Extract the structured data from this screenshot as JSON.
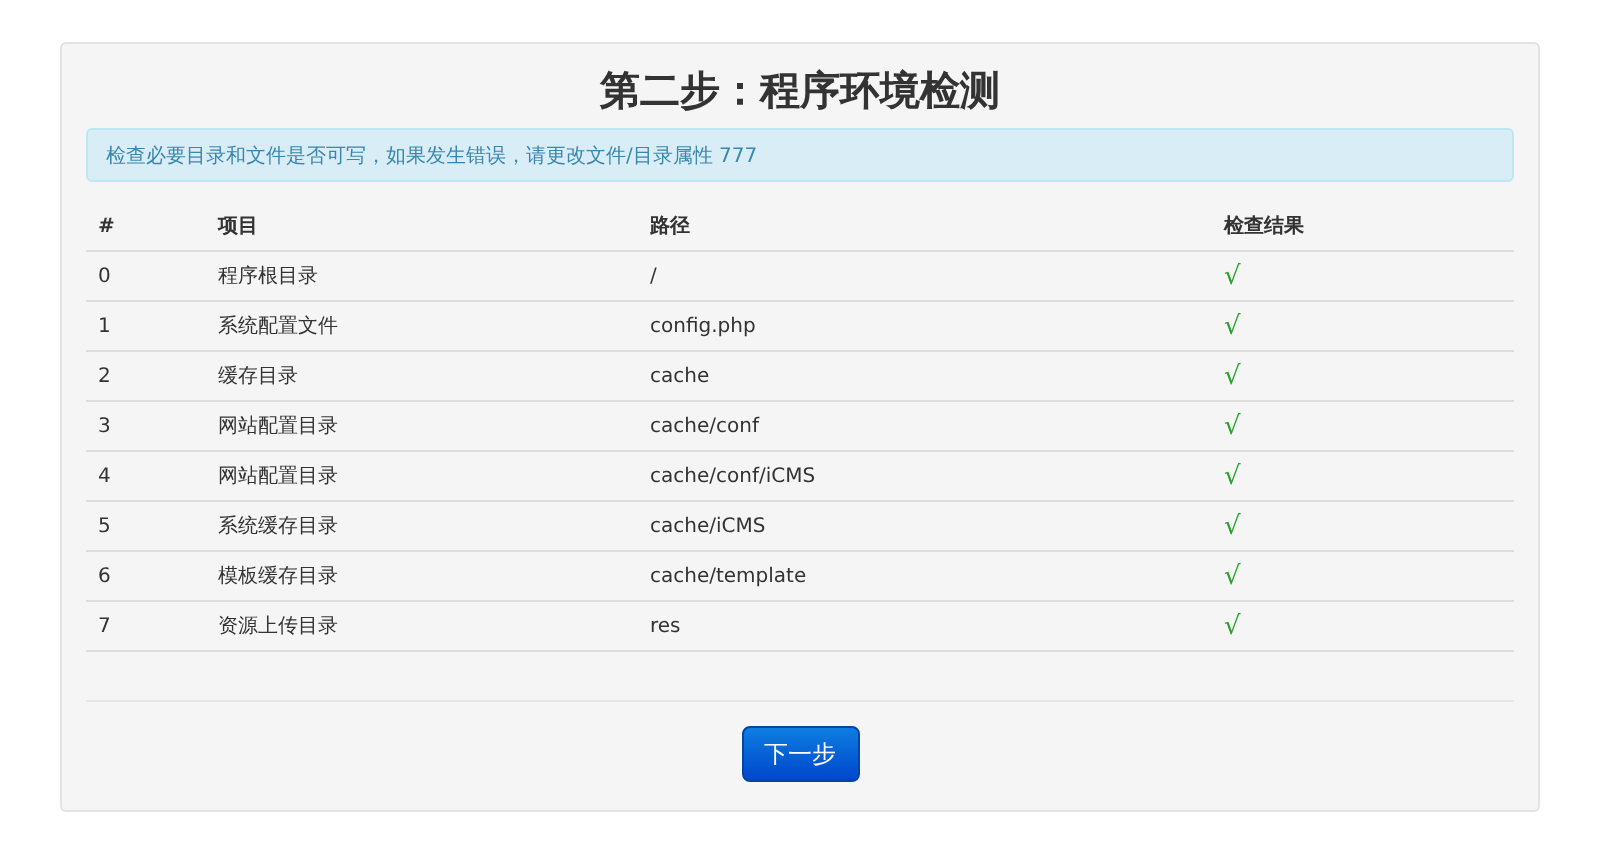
{
  "title": "第二步：程序环境检测",
  "alert": "检查必要目录和文件是否可写，如果发生错误，请更改文件/目录属性 777",
  "table": {
    "columns": [
      "#",
      "项目",
      "路径",
      "检查结果"
    ],
    "rows": [
      {
        "index": "0",
        "item": "程序根目录",
        "path": "/",
        "result": "√",
        "passed": true
      },
      {
        "index": "1",
        "item": "系统配置文件",
        "path": "config.php",
        "result": "√",
        "passed": true
      },
      {
        "index": "2",
        "item": "缓存目录",
        "path": "cache",
        "result": "√",
        "passed": true
      },
      {
        "index": "3",
        "item": "网站配置目录",
        "path": "cache/conf",
        "result": "√",
        "passed": true
      },
      {
        "index": "4",
        "item": "网站配置目录",
        "path": "cache/conf/iCMS",
        "result": "√",
        "passed": true
      },
      {
        "index": "5",
        "item": "系统缓存目录",
        "path": "cache/iCMS",
        "result": "√",
        "passed": true
      },
      {
        "index": "6",
        "item": "模板缓存目录",
        "path": "cache/template",
        "result": "√",
        "passed": true
      },
      {
        "index": "7",
        "item": "资源上传目录",
        "path": "res",
        "result": "√",
        "passed": true
      }
    ]
  },
  "button": "下一步"
}
